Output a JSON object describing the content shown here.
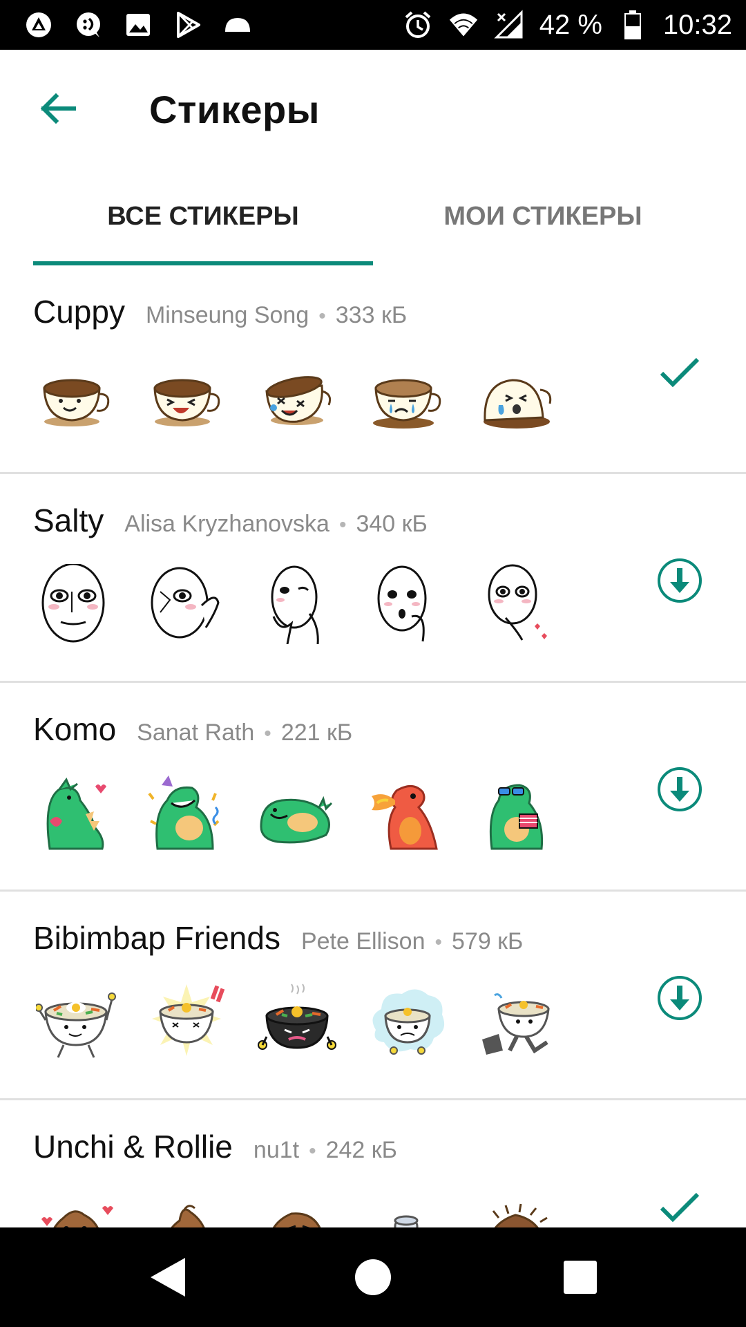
{
  "status_bar": {
    "battery_percent": "42 %",
    "time": "10:32",
    "left_icons": [
      "android-auto-icon",
      "chat-bubble-icon",
      "image-icon",
      "play-store-icon",
      "cloud-icon"
    ],
    "right_icons": [
      "alarm-icon",
      "wifi-icon",
      "cell-signal-icon",
      "battery-icon"
    ]
  },
  "toolbar": {
    "title": "Стикеры",
    "back_icon": "arrow-left-icon"
  },
  "tabs": [
    {
      "label": "ВСЕ СТИКЕРЫ",
      "selected": true
    },
    {
      "label": "МОИ СТИКЕРЫ",
      "selected": false
    }
  ],
  "packs": [
    {
      "name": "Cuppy",
      "author": "Minseung Song",
      "size": "333 кБ",
      "status": "installed",
      "stickers": [
        "cup",
        "cup",
        "cup",
        "cup",
        "cup"
      ]
    },
    {
      "name": "Salty",
      "author": "Alisa Kryzhanovska",
      "size": "340 кБ",
      "status": "download",
      "stickers": [
        "face",
        "face",
        "face",
        "face",
        "face"
      ]
    },
    {
      "name": "Komo",
      "author": "Sanat Rath",
      "size": "221 кБ",
      "status": "download",
      "stickers": [
        "dino",
        "dino",
        "dino-red",
        "dino",
        "dino"
      ]
    },
    {
      "name": "Bibimbap Friends",
      "author": "Pete Ellison",
      "size": "579 кБ",
      "status": "download",
      "stickers": [
        "bowl",
        "bowl",
        "bowl-dark",
        "bowl",
        "bowl"
      ]
    },
    {
      "name": "Unchi & Rollie",
      "author": "nu1t",
      "size": "242 кБ",
      "status": "installed",
      "stickers": [
        "poop",
        "poop",
        "poop",
        "roll",
        "poop"
      ]
    }
  ],
  "colors": {
    "accent": "#0b8a7a",
    "divider": "#e0e0e0",
    "meta_text": "#8a8a8a"
  },
  "nav_bar": {
    "icons": [
      "back-triangle-icon",
      "home-circle-icon",
      "recents-square-icon"
    ]
  }
}
